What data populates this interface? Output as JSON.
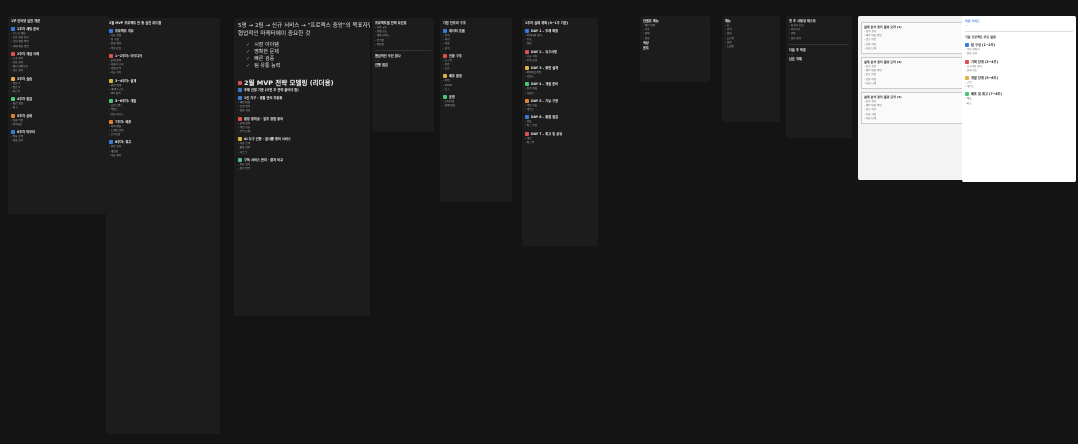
{
  "col1": {
    "title": "1부 인터넷 실전 개론",
    "sections": [
      {
        "h": "1주차 세팅 준비",
        "lines": [
          "- 노트북 세팅",
          "- 기본 개념 정리",
          "- 가입 계정 확인",
          "- 과제 제출 방법"
        ]
      },
      {
        "h": "2주차 개념 이해",
        "lines": [
          "- 구조 파악",
          "- 흐름 정리",
          "- 예시 살펴보기",
          "- 질문 정리"
        ]
      },
      {
        "h": "3주차 실습",
        "lines": [
          "- 실습 1",
          "- 실습 2",
          "- 피드백"
        ]
      },
      {
        "h": "4주차 점검",
        "lines": [
          "- 중간 점검",
          "- 회고"
        ]
      },
      {
        "h": "5주차 심화",
        "lines": [
          "- 심화 학습",
          "- 질의응답"
        ]
      },
      {
        "h": "6주차 마무리",
        "lines": [
          "- 발표 준비",
          "- 최종 정리"
        ]
      }
    ]
  },
  "col2": {
    "title": "2월 MVP 프로젝트 전 총 실전 로드맵",
    "sections": [
      {
        "h": "프로젝트 개요",
        "lines": [
          "- 목표 설정",
          "- 팀 구성",
          "- 일정 계획",
          "- 역할 분담"
        ]
      },
      {
        "h": "1~2주차: 아이디어",
        "lines": [
          "- 문제 정의",
          "- 사용자 조사",
          "- 경쟁 분석",
          "- 기능 목록"
        ]
      },
      {
        "h": "3~4주차: 설계",
        "lines": [
          "- 화면 설계",
          "- 데이터 구조",
          "- API 정의"
        ]
      },
      {
        "h": "5~6주차: 개발",
        "lines": [
          "- 프론트엔드",
          "- 백엔드",
          "- 연동 테스트"
        ]
      },
      {
        "h": "7주차: 배포",
        "lines": [
          "- 서버 세팅",
          "- 도메인 연결",
          "- 모니터링"
        ]
      },
      {
        "h": "8주차: 회고",
        "lines": [
          "- 결과 정리",
          "- 개선점",
          "- 다음 계획"
        ]
      }
    ]
  },
  "main": {
    "intro": [
      "5명 → 2팀 → 신규 서비스 → \"프로젝스 중앙\"의 목표자연",
      "협업적인 마케터에이 중요한 것"
    ],
    "checks": [
      "시장 아이템",
      "명확한 문제",
      "빠른 검증",
      "팀 유통 능력"
    ],
    "headline": "2월 MVP 전략 모델링 (리더용)",
    "subhead": "주제 선정 기준 (이런 주 전략 끌어야 함)",
    "blocks": [
      {
        "h": "1인 가구 · 생활 관리 자동화",
        "lines": [
          "- 해결 대상",
          "- 진행 방식",
          "- 검증 지표"
        ]
      },
      {
        "h": "중장 중하공 · 업프 경험 중의",
        "lines": [
          "- 문제 정의",
          "- 핵심 기능",
          "- 수익 모델"
        ]
      },
      {
        "h": "AI 도구 선형 · 발사뽑 형의 서비스",
        "lines": [
          "- 기술 스택",
          "- 활용 범위",
          "- 리스크"
        ]
      },
      {
        "h": "구독 서비스 관리 · 결과 비교",
        "lines": [
          "- 비교 항목",
          "- 정리 방식"
        ]
      }
    ]
  },
  "col4": {
    "title": "프로젝트별 전략 요인표",
    "lines": [
      "- 시장 규모",
      "- 경쟁 강도",
      "- 개발 난이도",
      "- 수익성",
      "- 확장성"
    ],
    "sub": "핸심적인 우선 원나",
    "sub2": "진행 점검"
  },
  "col5": {
    "title": "기본 인프라 구조",
    "sections": [
      {
        "h": "데이터 흐름",
        "lines": [
          "- 입력",
          "- 처리",
          "- 저장",
          "- 출력"
        ]
      },
      {
        "h": "인증 구조",
        "lines": [
          "- 로그인",
          "- 권한",
          "- 토큰"
        ]
      },
      {
        "h": "배포 환경",
        "lines": [
          "- 서버",
          "- CI/CD",
          "- 로그"
        ]
      },
      {
        "h": "운영",
        "lines": [
          "- 모니터링",
          "- 장애 대응"
        ]
      }
    ]
  },
  "col6": {
    "title": "1주차 실제 계획 (0~1주 기준)",
    "sections": [
      {
        "h": "DAY 1 – 주제 확정",
        "lines": [
          "- 아이디어 정리",
          "- 투표",
          "- 결정"
        ]
      },
      {
        "h": "DAY 2 – 요구사항",
        "lines": [
          "- 기능 목록",
          "- 우선 순위"
        ]
      },
      {
        "h": "DAY 3 – 화면 설계",
        "lines": [
          "- 와이어프레임",
          "- 흐름도"
        ]
      },
      {
        "h": "DAY 4 – 개발 준비",
        "lines": [
          "- 환경 세팅",
          "- 저장소"
        ]
      },
      {
        "h": "DAY 5 – 기능 구현",
        "lines": [
          "- 핵심 기능",
          "- 테스트"
        ]
      },
      {
        "h": "DAY 6 – 통합 점검",
        "lines": [
          "- 연동",
          "- 버그 수정"
        ]
      },
      {
        "h": "DAY 7 – 회고 및 공유",
        "lines": [
          "- 데모",
          "- 피드백"
        ]
      }
    ]
  },
  "col7": {
    "title": "컨셉트 메뉴",
    "lines": [
      "- 메인 화면",
      "- 목록",
      "- 상세",
      "- 설정"
    ],
    "sub": "색상",
    "sub2": "폰트"
  },
  "col8": {
    "title": "메뉴",
    "lines": [
      "- 홈",
      "- 검색",
      "- 알림",
      "- 프로필",
      "- 설정",
      "- 도움말"
    ]
  },
  "col9": {
    "title": "첫 주 사용성 테스트",
    "lines": [
      "- 참가자 모집",
      "- 시나리오",
      "- 관찰",
      "- 결과 정리"
    ],
    "sub": "다음 주 목표",
    "sub2": "남은 과제"
  },
  "doc1": {
    "items": [
      "설계 분석 정리 결과 요약 (1)",
      "설계 분석 정리 결과 요약 (2)",
      "설계 분석 정리 결과 요약 (3)"
    ],
    "lines": [
      "- 항목 정리",
      "- 세부 내용 확인",
      "- 검토 의견",
      "- 보완 사항",
      "- 다음 단계"
    ]
  },
  "doc2": {
    "header": "작성 가이드",
    "title": "기본 프로젝트 주요 일정",
    "sections": [
      {
        "h": "팀 구성 (1~2주)",
        "lines": [
          "- 역할 정하기",
          "- 일정 공유"
        ]
      },
      {
        "h": "기획 단계 (3~4주)",
        "lines": [
          "- 요구사항 정리",
          "- 설계 검토"
        ]
      },
      {
        "h": "개발 단계 (5~6주)",
        "lines": [
          "- 구현",
          "- 테스트"
        ]
      },
      {
        "h": "배포 및 회고 (7~8주)",
        "lines": [
          "- 배포",
          "- 회고"
        ]
      }
    ]
  }
}
